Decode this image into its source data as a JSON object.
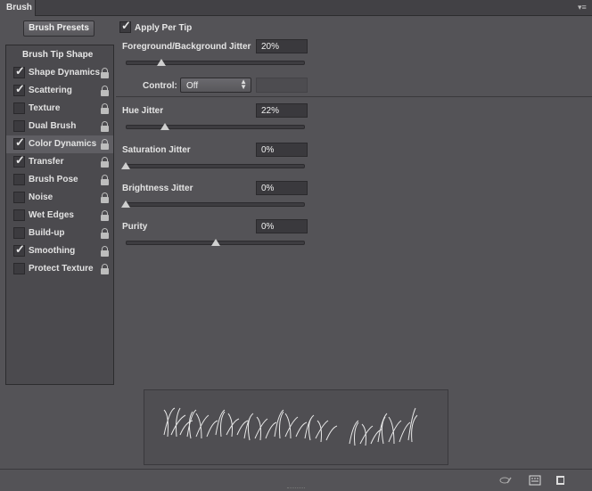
{
  "window": {
    "tab_title": "Brush"
  },
  "toolbar": {
    "presets_label": "Brush Presets"
  },
  "sidebar": {
    "header": "Brush Tip Shape",
    "items": [
      {
        "label": "Shape Dynamics",
        "checked": true
      },
      {
        "label": "Scattering",
        "checked": true
      },
      {
        "label": "Texture",
        "checked": false
      },
      {
        "label": "Dual Brush",
        "checked": false
      },
      {
        "label": "Color Dynamics",
        "checked": true,
        "selected": true
      },
      {
        "label": "Transfer",
        "checked": true
      },
      {
        "label": "Brush Pose",
        "checked": false
      },
      {
        "label": "Noise",
        "checked": false
      },
      {
        "label": "Wet Edges",
        "checked": false
      },
      {
        "label": "Build-up",
        "checked": false
      },
      {
        "label": "Smoothing",
        "checked": true
      },
      {
        "label": "Protect Texture",
        "checked": false
      }
    ]
  },
  "options": {
    "apply_per_tip_label": "Apply Per Tip",
    "apply_per_tip_checked": true,
    "control_label": "Control:",
    "control_value": "Off",
    "params": [
      {
        "label": "Foreground/Background Jitter",
        "value": "20%",
        "level": 0.2
      },
      {
        "label": "Hue Jitter",
        "value": "22%",
        "level": 0.22
      },
      {
        "label": "Saturation Jitter",
        "value": "0%",
        "level": 0
      },
      {
        "label": "Brightness Jitter",
        "value": "0%",
        "level": 0
      },
      {
        "label": "Purity",
        "value": "0%",
        "level": 0.5
      }
    ]
  },
  "colors": {
    "panel_bg": "#545357",
    "accent_check": "#e6e6e6"
  }
}
